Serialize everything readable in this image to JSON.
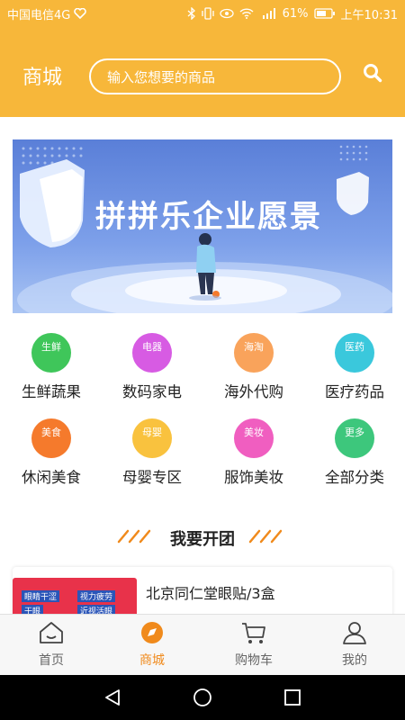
{
  "status_bar": {
    "carrier": "中国电信4G",
    "battery": "61%",
    "time": "上午10:31"
  },
  "header": {
    "title": "商城",
    "search_placeholder": "输入您想要的商品"
  },
  "banner": {
    "title": "拼拼乐企业愿景"
  },
  "categories": [
    {
      "badge": "生鲜",
      "label": "生鲜蔬果",
      "color": "#3fc65a"
    },
    {
      "badge": "电器",
      "label": "数码家电",
      "color": "#d75be3"
    },
    {
      "badge": "海淘",
      "label": "海外代购",
      "color": "#f9a35b"
    },
    {
      "badge": "医药",
      "label": "医疗药品",
      "color": "#3ac8dc"
    },
    {
      "badge": "美食",
      "label": "休闲美食",
      "color": "#f57a2c"
    },
    {
      "badge": "母婴",
      "label": "母婴专区",
      "color": "#f9c23e"
    },
    {
      "badge": "美妆",
      "label": "服饰美妆",
      "color": "#f05ec0"
    },
    {
      "badge": "更多",
      "label": "全部分类",
      "color": "#3dc77c"
    }
  ],
  "section": {
    "title": "我要开团"
  },
  "product": {
    "title": "北京同仁堂眼贴/3盒",
    "tags": [
      "眼睛干涩",
      "视力疲劳",
      "干眼",
      "近视活眼"
    ]
  },
  "tabbar": {
    "items": [
      {
        "label": "首页",
        "icon": "home-icon"
      },
      {
        "label": "商城",
        "icon": "mall-icon"
      },
      {
        "label": "购物车",
        "icon": "cart-icon"
      },
      {
        "label": "我的",
        "icon": "user-icon"
      }
    ],
    "active_index": 1
  },
  "colors": {
    "brand": "#f7b73a",
    "active": "#f08a1c"
  }
}
